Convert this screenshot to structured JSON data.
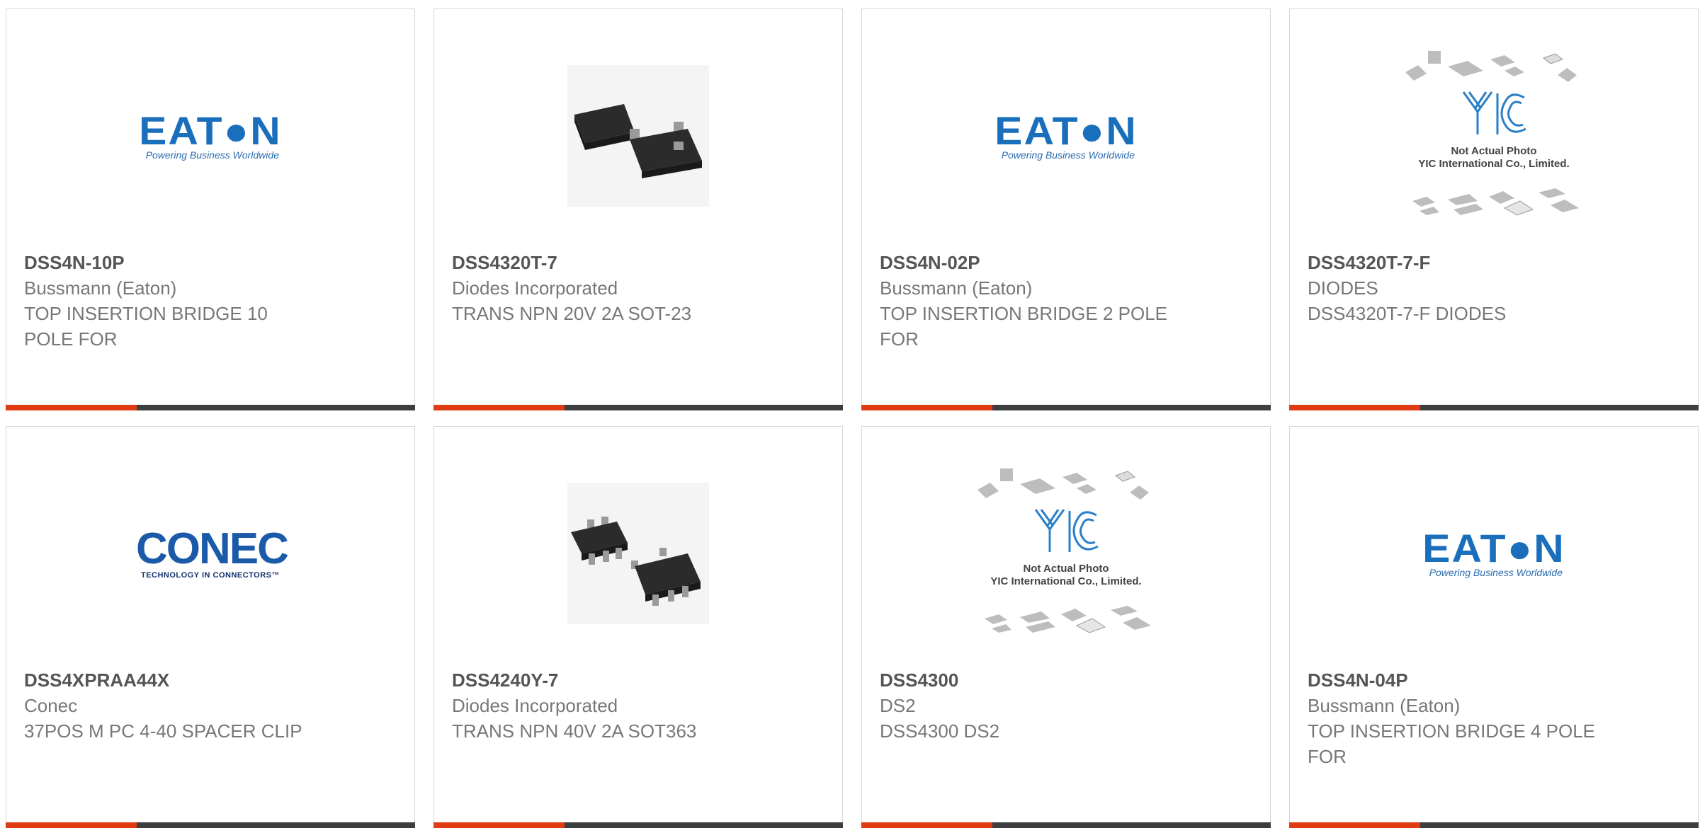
{
  "products": [
    {
      "pn": "DSS4N-10P",
      "mfr": "Bussmann (Eaton)",
      "desc": "TOP INSERTION BRIDGE 10 POLE FOR",
      "image": "eaton-logo"
    },
    {
      "pn": "DSS4320T-7",
      "mfr": "Diodes Incorporated",
      "desc": "TRANS NPN 20V 2A SOT-23",
      "image": "sot23-photo"
    },
    {
      "pn": "DSS4N-02P",
      "mfr": "Bussmann (Eaton)",
      "desc": "TOP INSERTION BRIDGE 2 POLE FOR",
      "image": "eaton-logo"
    },
    {
      "pn": "DSS4320T-7-F",
      "mfr": "DIODES",
      "desc": "DSS4320T-7-F DIODES",
      "image": "yic-placeholder"
    },
    {
      "pn": "DSS4XPRAA44X",
      "mfr": "Conec",
      "desc": "37POS M PC 4-40 SPACER CLIP",
      "image": "conec-logo"
    },
    {
      "pn": "DSS4240Y-7",
      "mfr": "Diodes Incorporated",
      "desc": "TRANS NPN 40V 2A SOT363",
      "image": "sot363-photo"
    },
    {
      "pn": "DSS4300",
      "mfr": "DS2",
      "desc": "DSS4300 DS2",
      "image": "yic-placeholder"
    },
    {
      "pn": "DSS4N-04P",
      "mfr": "Bussmann (Eaton)",
      "desc": "TOP INSERTION BRIDGE 4 POLE FOR",
      "image": "eaton-logo"
    }
  ],
  "logos": {
    "eaton": {
      "word": "EAT●N",
      "tagline": "Powering Business Worldwide"
    },
    "conec": {
      "word": "CONEC",
      "tagline": "TECHNOLOGY IN CONNECTORS™"
    },
    "yic": {
      "line1": "Not Actual Photo",
      "line2": "YIC International Co., Limited."
    }
  },
  "colors": {
    "accent": "#e03c14",
    "bar": "#3d3e40",
    "eaton_blue": "#1a6fbd",
    "conec_blue": "#1a5aa8"
  }
}
